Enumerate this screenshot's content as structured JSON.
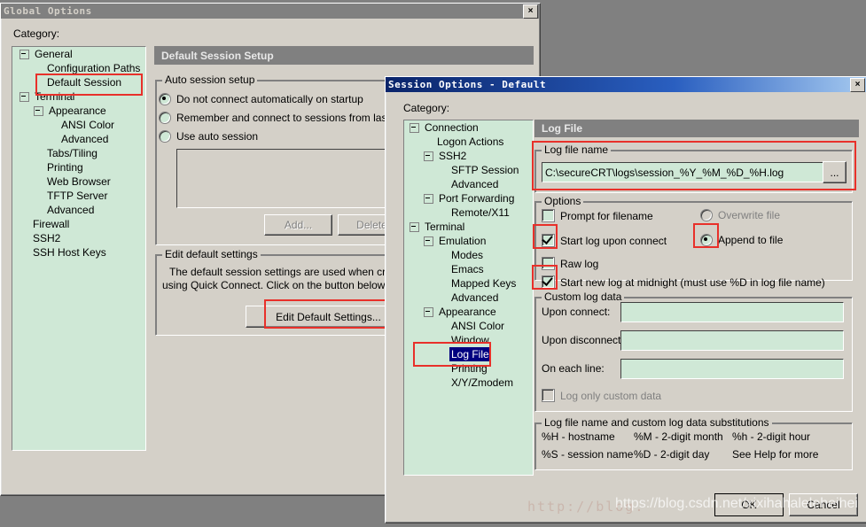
{
  "global_options": {
    "title": "Global Options",
    "close_label": "×",
    "category_label": "Category:",
    "tree": [
      {
        "label": "General",
        "indent": 0,
        "expander": true
      },
      {
        "label": "Configuration Paths",
        "indent": 1,
        "expander": false
      },
      {
        "label": "Default Session",
        "indent": 1,
        "expander": false,
        "highlight": true
      },
      {
        "label": "Terminal",
        "indent": 0,
        "expander": true
      },
      {
        "label": "Appearance",
        "indent": 1,
        "expander": true
      },
      {
        "label": "ANSI Color",
        "indent": 2,
        "expander": false
      },
      {
        "label": "Advanced",
        "indent": 2,
        "expander": false
      },
      {
        "label": "Tabs/Tiling",
        "indent": 1,
        "expander": false
      },
      {
        "label": "Printing",
        "indent": 1,
        "expander": false
      },
      {
        "label": "Web Browser",
        "indent": 1,
        "expander": false
      },
      {
        "label": "TFTP Server",
        "indent": 1,
        "expander": false
      },
      {
        "label": "Advanced",
        "indent": 1,
        "expander": false
      },
      {
        "label": "Firewall",
        "indent": 0,
        "expander": false
      },
      {
        "label": "SSH2",
        "indent": 0,
        "expander": false
      },
      {
        "label": "SSH Host Keys",
        "indent": 0,
        "expander": false
      }
    ],
    "pane_header": "Default Session Setup",
    "auto_session": {
      "legend": "Auto session setup",
      "radios": [
        {
          "label": "Do not connect automatically on startup",
          "checked": true
        },
        {
          "label": "Remember and connect to sessions from last use",
          "checked": false
        },
        {
          "label": "Use auto session",
          "checked": false
        }
      ],
      "add_button": "Add...",
      "delete_button": "Delete"
    },
    "edit_default": {
      "legend": "Edit default settings",
      "line1": "The default session settings are used when creating",
      "line2": "using Quick Connect.  Click on the button below to",
      "button": "Edit Default Settings..."
    }
  },
  "session_options": {
    "title": "Session Options - Default",
    "close_label": "×",
    "category_label": "Category:",
    "tree": [
      {
        "label": "Connection",
        "indent": 0,
        "expander": true
      },
      {
        "label": "Logon Actions",
        "indent": 1,
        "expander": false
      },
      {
        "label": "SSH2",
        "indent": 1,
        "expander": true
      },
      {
        "label": "SFTP Session",
        "indent": 2,
        "expander": false
      },
      {
        "label": "Advanced",
        "indent": 2,
        "expander": false
      },
      {
        "label": "Port Forwarding",
        "indent": 1,
        "expander": true
      },
      {
        "label": "Remote/X11",
        "indent": 2,
        "expander": false
      },
      {
        "label": "Terminal",
        "indent": 0,
        "expander": true
      },
      {
        "label": "Emulation",
        "indent": 1,
        "expander": true
      },
      {
        "label": "Modes",
        "indent": 2,
        "expander": false
      },
      {
        "label": "Emacs",
        "indent": 2,
        "expander": false
      },
      {
        "label": "Mapped Keys",
        "indent": 2,
        "expander": false
      },
      {
        "label": "Advanced",
        "indent": 2,
        "expander": false
      },
      {
        "label": "Appearance",
        "indent": 1,
        "expander": true
      },
      {
        "label": "ANSI Color",
        "indent": 2,
        "expander": false
      },
      {
        "label": "Window",
        "indent": 2,
        "expander": false
      },
      {
        "label": "Log File",
        "indent": 2,
        "expander": false,
        "selected": true,
        "highlight": true
      },
      {
        "label": "Printing",
        "indent": 2,
        "expander": false
      },
      {
        "label": "X/Y/Zmodem",
        "indent": 2,
        "expander": false
      }
    ],
    "pane_header": "Log File",
    "log_file_name": {
      "legend": "Log file name",
      "value": "C:\\secureCRT\\logs\\session_%Y_%M_%D_%H.log",
      "browse_button": "..."
    },
    "options": {
      "legend": "Options",
      "checks": [
        {
          "label": "Prompt for filename",
          "checked": false,
          "highlight": false
        },
        {
          "label": "Start log upon connect",
          "checked": true,
          "highlight": true
        },
        {
          "label": "Raw log",
          "checked": false,
          "highlight": false
        },
        {
          "label": "Start new log at midnight (must use %D in log file name)",
          "checked": true,
          "highlight": true
        }
      ],
      "radios": [
        {
          "label": "Overwrite file",
          "checked": false,
          "disabled": true,
          "highlight": false
        },
        {
          "label": "Append to file",
          "checked": true,
          "disabled": false,
          "highlight": true
        }
      ]
    },
    "custom_log_data": {
      "legend": "Custom log data",
      "fields": [
        {
          "label": "Upon connect:",
          "value": ""
        },
        {
          "label": "Upon disconnect:",
          "value": ""
        },
        {
          "label": "On each line:",
          "value": ""
        }
      ],
      "check": {
        "label": "Log only custom data",
        "checked": false,
        "disabled": true
      }
    },
    "substitutions": {
      "legend": "Log file name and custom log data substitutions",
      "row1": [
        "%H - hostname",
        "%M - 2-digit month",
        "%h - 2-digit hour"
      ],
      "row2": [
        "%S - session name",
        "%D - 2-digit day",
        "See Help for more"
      ]
    },
    "ok_button": "OK",
    "cancel_button": "Cancel"
  },
  "watermarks": {
    "back": "http://blog.",
    "front": "https://blog.csdn.net/xixihahaleleheihei"
  }
}
